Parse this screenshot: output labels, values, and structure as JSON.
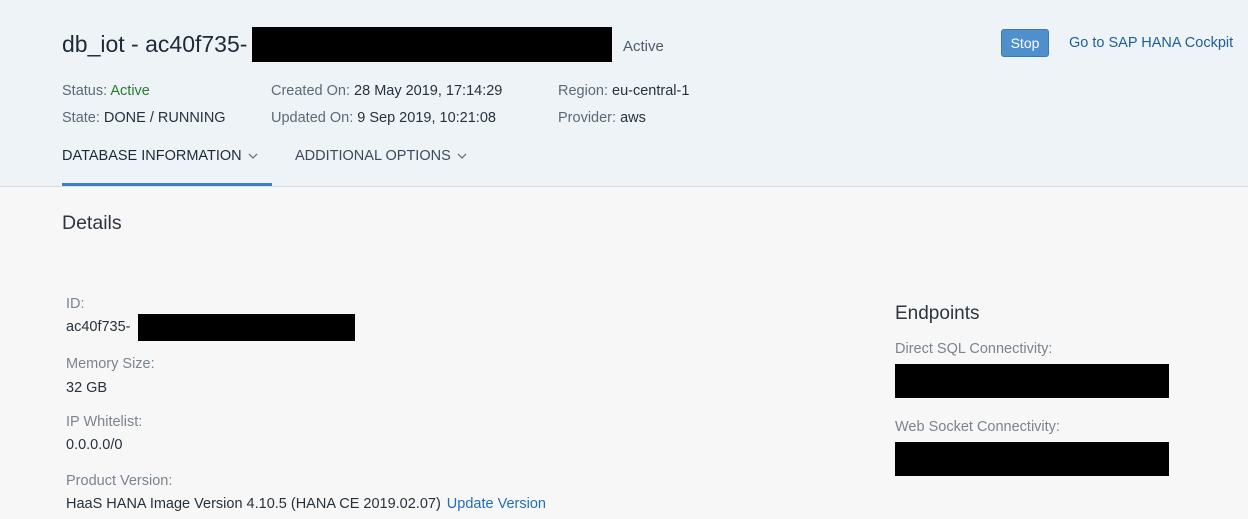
{
  "header": {
    "title": "db_iot - ac40f735-",
    "title_status": "Active",
    "stop_label": "Stop",
    "cockpit_link": "Go to SAP HANA Cockpit",
    "status_label": "Status:",
    "status_value": "Active",
    "state_label": "State:",
    "state_value": "DONE / RUNNING",
    "created_label": "Created On:",
    "created_value": "28 May 2019, 17:14:29",
    "updated_label": "Updated On:",
    "updated_value": "9 Sep 2019, 10:21:08",
    "region_label": "Region:",
    "region_value": "eu-central-1",
    "provider_label": "Provider:",
    "provider_value": "aws",
    "colors": {
      "accent": "#4f8fcc",
      "active_green": "#2b7d2b",
      "link": "#1f5e96"
    }
  },
  "tabs": [
    {
      "label": "DATABASE INFORMATION",
      "icon": "chevron-down-icon",
      "active": true
    },
    {
      "label": "ADDITIONAL OPTIONS",
      "icon": "chevron-down-icon",
      "active": false
    }
  ],
  "details": {
    "title": "Details",
    "id_label": "ID:",
    "id_value": "ac40f735-",
    "memory_label": "Memory Size:",
    "memory_value": "32 GB",
    "ip_label": "IP Whitelist:",
    "ip_value": "0.0.0.0/0",
    "product_label": "Product Version:",
    "product_value": "HaaS HANA Image Version 4.10.5 (HANA CE 2019.02.07)",
    "update_link": "Update Version"
  },
  "endpoints": {
    "title": "Endpoints",
    "sql_label": "Direct SQL Connectivity:",
    "websocket_label": "Web Socket Connectivity:"
  }
}
